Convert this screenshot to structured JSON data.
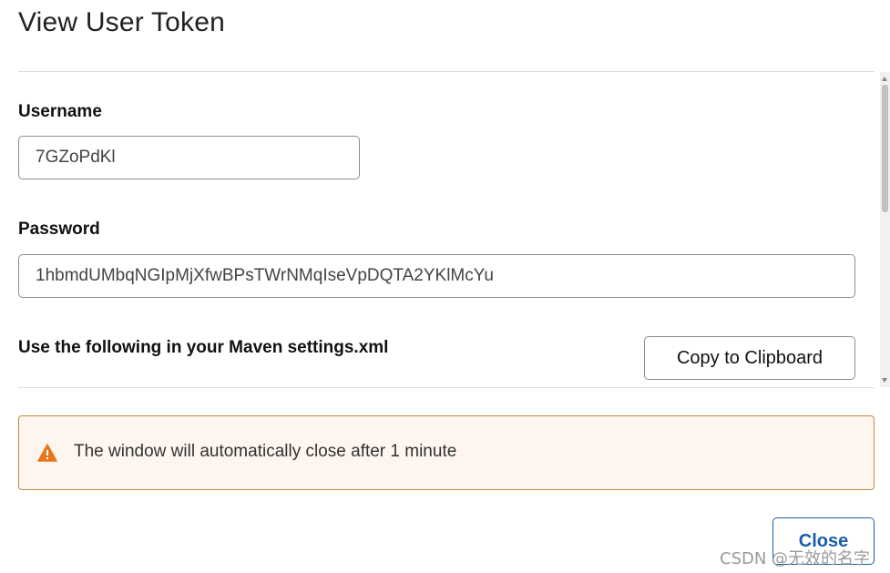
{
  "dialog": {
    "title": "View User Token"
  },
  "username": {
    "label": "Username",
    "value": "7GZoPdKl"
  },
  "password": {
    "label": "Password",
    "value": "1hbmdUMbqNGIpMjXfwBPsTWrNMqIseVpDQTA2YKlMcYu"
  },
  "maven": {
    "label": "Use the following in your Maven settings.xml",
    "copy_label": "Copy to Clipboard"
  },
  "alert": {
    "icon": "warning-triangle-icon",
    "color": "#e8771c",
    "text": "The window will automatically close after 1 minute"
  },
  "footer": {
    "close_label": "Close"
  },
  "watermark": {
    "text": "CSDN @无效的名字"
  },
  "colors": {
    "primary": "#1a5ea8",
    "alert_border": "#c98a3c",
    "alert_background": "#fdf5ee"
  }
}
